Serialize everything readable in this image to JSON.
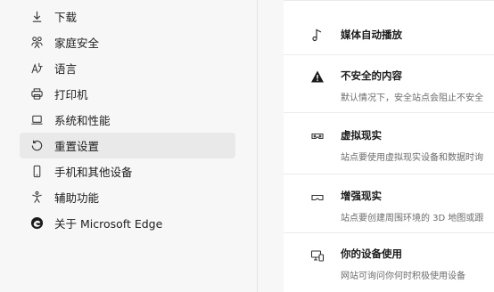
{
  "sidebar": {
    "items": [
      {
        "label": "下载",
        "icon": "download-icon"
      },
      {
        "label": "家庭安全",
        "icon": "family-icon"
      },
      {
        "label": "语言",
        "icon": "language-icon"
      },
      {
        "label": "打印机",
        "icon": "printer-icon"
      },
      {
        "label": "系统和性能",
        "icon": "laptop-icon"
      },
      {
        "label": "重置设置",
        "icon": "reset-icon",
        "active": true
      },
      {
        "label": "手机和其他设备",
        "icon": "phone-icon"
      },
      {
        "label": "辅助功能",
        "icon": "accessibility-icon"
      },
      {
        "label": "关于 Microsoft Edge",
        "icon": "edge-logo-icon"
      }
    ]
  },
  "main": {
    "rows": [
      {
        "title": "媒体自动播放",
        "desc": "",
        "icon": "music-note-icon"
      },
      {
        "title": "不安全的内容",
        "desc": "默认情况下，安全站点会阻止不安全",
        "icon": "warning-icon"
      },
      {
        "title": "虚拟现实",
        "desc": "站点要使用虚拟现实设备和数据时询",
        "icon": "vr-headset-icon"
      },
      {
        "title": "增强现实",
        "desc": "站点要创建周围环境的 3D 地图或跟",
        "icon": "ar-headset-icon"
      },
      {
        "title": "你的设备使用",
        "desc": "网站可询问你何时积极使用设备",
        "icon": "device-usage-icon"
      }
    ]
  },
  "colors": {
    "active_bg": "#e9e9e9",
    "panel_bg": "#f7f7f7",
    "card_bg": "#ffffff"
  }
}
